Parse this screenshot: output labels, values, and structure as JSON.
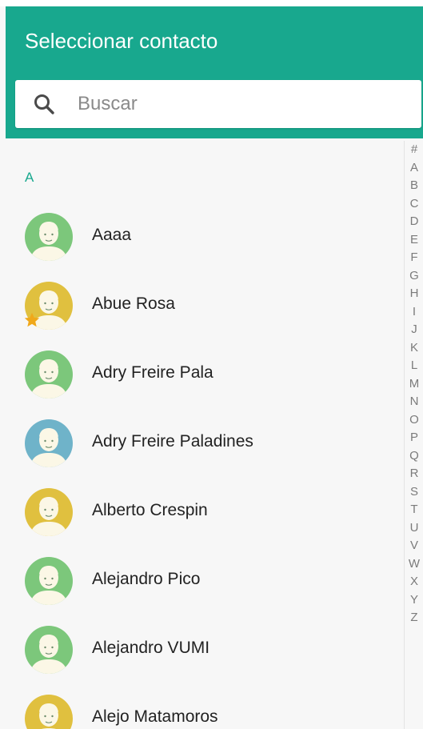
{
  "header": {
    "title": "Seleccionar contacto"
  },
  "search": {
    "placeholder": "Buscar",
    "icon": "search-icon"
  },
  "list": {
    "section": "A",
    "contacts": [
      {
        "name": "Aaaa",
        "avatar_color": "#7cc77b",
        "favorite": false
      },
      {
        "name": "Abue Rosa",
        "avatar_color": "#e0c03f",
        "favorite": true
      },
      {
        "name": "Adry Freire Pala",
        "avatar_color": "#7cc77b",
        "favorite": false
      },
      {
        "name": "Adry Freire Paladines",
        "avatar_color": "#6fb3c9",
        "favorite": false
      },
      {
        "name": "Alberto Crespin",
        "avatar_color": "#e0c03f",
        "favorite": false
      },
      {
        "name": "Alejandro Pico",
        "avatar_color": "#7cc77b",
        "favorite": false
      },
      {
        "name": "Alejandro VUMI",
        "avatar_color": "#7cc77b",
        "favorite": false
      },
      {
        "name": "Alejo Matamoros",
        "avatar_color": "#e0c03f",
        "favorite": false
      }
    ]
  },
  "index_bar": [
    "#",
    "A",
    "B",
    "C",
    "D",
    "E",
    "F",
    "G",
    "H",
    "I",
    "J",
    "K",
    "L",
    "M",
    "N",
    "O",
    "P",
    "Q",
    "R",
    "S",
    "T",
    "U",
    "V",
    "W",
    "X",
    "Y",
    "Z"
  ],
  "colors": {
    "accent": "#18a88e",
    "favorite_star": "#f0a81a"
  }
}
